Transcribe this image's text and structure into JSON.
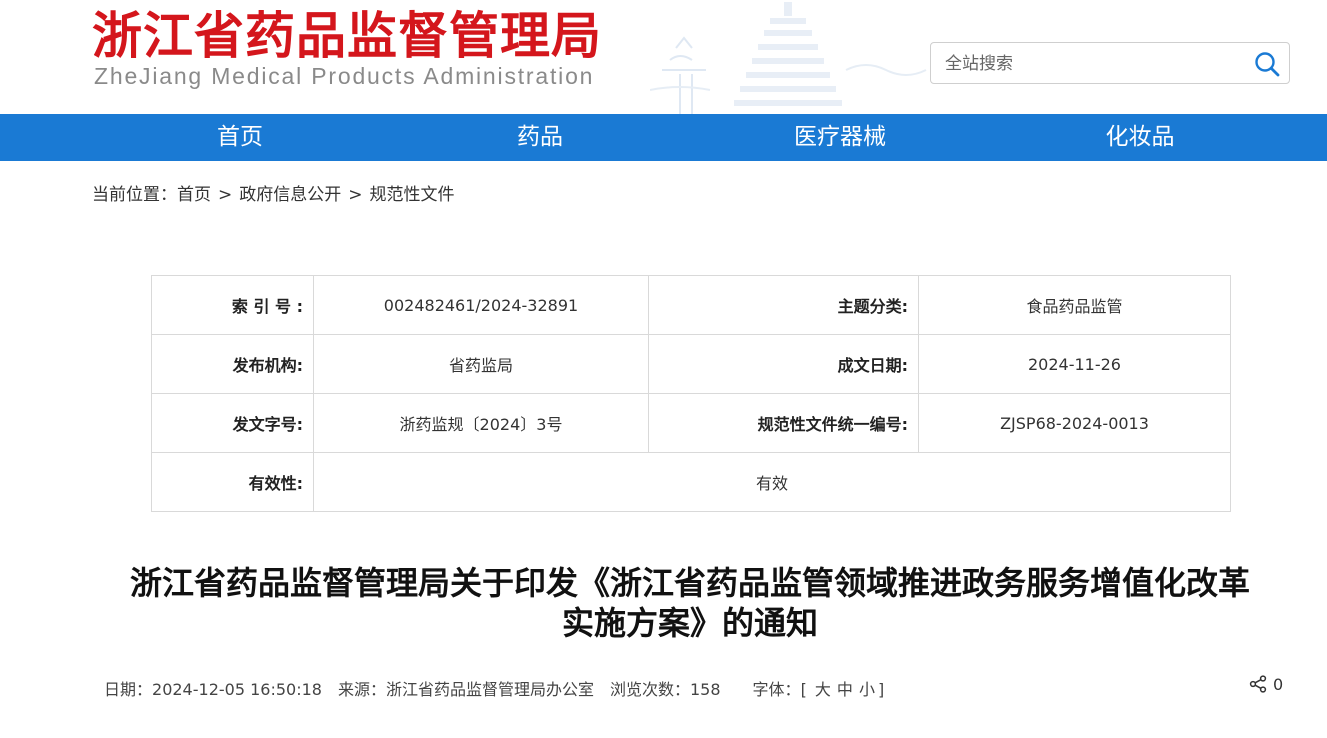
{
  "header": {
    "logo_cn": "浙江省药品监督管理局",
    "logo_en": "ZheJiang Medical Products Administration",
    "search_placeholder": "全站搜索"
  },
  "nav": [
    {
      "label": "首页"
    },
    {
      "label": "药品"
    },
    {
      "label": "医疗器械"
    },
    {
      "label": "化妆品"
    }
  ],
  "breadcrumb": {
    "prefix": "当前位置：",
    "items": [
      "首页",
      "政府信息公开",
      "规范性文件"
    ],
    "separator": ">"
  },
  "info": {
    "index_label": "索 引 号 :",
    "index_value": "002482461/2024-32891",
    "topic_label": "主题分类:",
    "topic_value": "食品药品监管",
    "publisher_label": "发布机构:",
    "publisher_value": "省药监局",
    "date_label": "成文日期:",
    "date_value": "2024-11-26",
    "docno_label": "发文字号:",
    "docno_value": "浙药监规〔2024〕3号",
    "unified_label": "规范性文件统一编号:",
    "unified_value": "ZJSP68-2024-0013",
    "validity_label": "有效性:",
    "validity_value": "有效"
  },
  "article": {
    "title_line1": "浙江省药品监督管理局关于印发《浙江省药品监管领域推进政务服务增值化改革",
    "title_line2": "实施方案》的通知"
  },
  "meta": {
    "date_label": "日期：",
    "date_value": "2024-12-05 16:50:18",
    "source_label": "来源：",
    "source_value": "浙江省药品监督管理局办公室",
    "views_label": "浏览次数：",
    "views_value": "158",
    "font_label": "字体：",
    "font_open": "[",
    "font_large": "大",
    "font_medium": "中",
    "font_small": "小",
    "font_close": "]",
    "share_count": "0"
  },
  "colors": {
    "brand_red": "#d4161c",
    "nav_blue": "#1a7ad4"
  }
}
